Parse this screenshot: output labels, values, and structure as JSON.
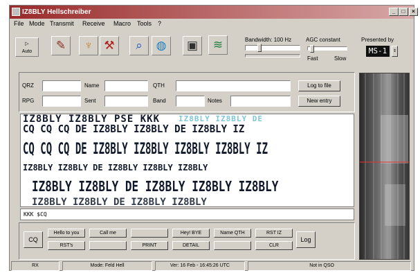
{
  "window": {
    "title": "IZ8BLY Hellschreiber"
  },
  "title_buttons": {
    "minimize": "_",
    "maximize": "□",
    "close": "×"
  },
  "menu": [
    "File",
    "Mode",
    "Transmit",
    "Receive",
    "Macro",
    "Tools",
    "?"
  ],
  "toolbar": {
    "first_label": "Auto",
    "icons": [
      "pencil-icon",
      "tuning-icon",
      "tools-icon",
      "search-icon",
      "globe-icon",
      "camera-icon",
      "graph-icon"
    ]
  },
  "controls": {
    "bandwidth_label": "Bandwidth: 100 Hz",
    "agc_label": "AGC constant",
    "agc_fast": "Fast",
    "agc_slow": "Slow",
    "preset_label": "Presented by",
    "preset_value": "MS-1"
  },
  "log": {
    "qrz_label": "QRZ",
    "name_label": "Name",
    "qth_label": "QTH",
    "rst_label": "RPG",
    "sent_label": "Sent",
    "band_label": "Band",
    "notes_label": "Notes",
    "log_button": "Log to file",
    "new_entry_button": "New entry"
  },
  "receive": {
    "line1": "IZ8BLY IZ8BLY PSE KKK",
    "line1_overlay": "IZ8BLY IZ8BLY DE",
    "line2": "CQ CQ CQ DE IZ8BLY IZ8BLY DE IZ8BLY IZ",
    "line3": "CQ CQ CQ DE IZ8BLY IZ8BLY IZ8BLY IZ8BLY IZ",
    "line4": "IZ8BLY IZ8BLY DE IZ8BLY IZ8BLY IZ8BLY",
    "line5": "IZ8BLY IZ8BLY DE IZ8BLY IZ8BLY IZ8BLY",
    "line6": "IZ8BLY IZ8BLY DE IZ8BLY IZ8BLY"
  },
  "transmit": {
    "text": "KKK $CQ"
  },
  "macros": {
    "cq": "CQ",
    "log": "Log",
    "row1": [
      "Hello to you",
      "Call me",
      "",
      "Hey! BYE",
      "Name QTH",
      "RST IZ"
    ],
    "row2": [
      "RST's",
      "",
      "PRINT",
      "DETAIL",
      "",
      "CLR"
    ]
  },
  "status": {
    "left": "RX",
    "mode": "Mode: Feld Hell",
    "time": "Ver: 16 Feb - 16:45:26 UTC",
    "right": "Not in QSO"
  },
  "colors": {
    "title_start": "#9a2a2a",
    "title_end": "#d8a8a8",
    "panel": "#d4d0c8",
    "waterfall_marker": "#e83030",
    "receive_text": "#10182a",
    "receive_highlight": "#48b0c8"
  }
}
